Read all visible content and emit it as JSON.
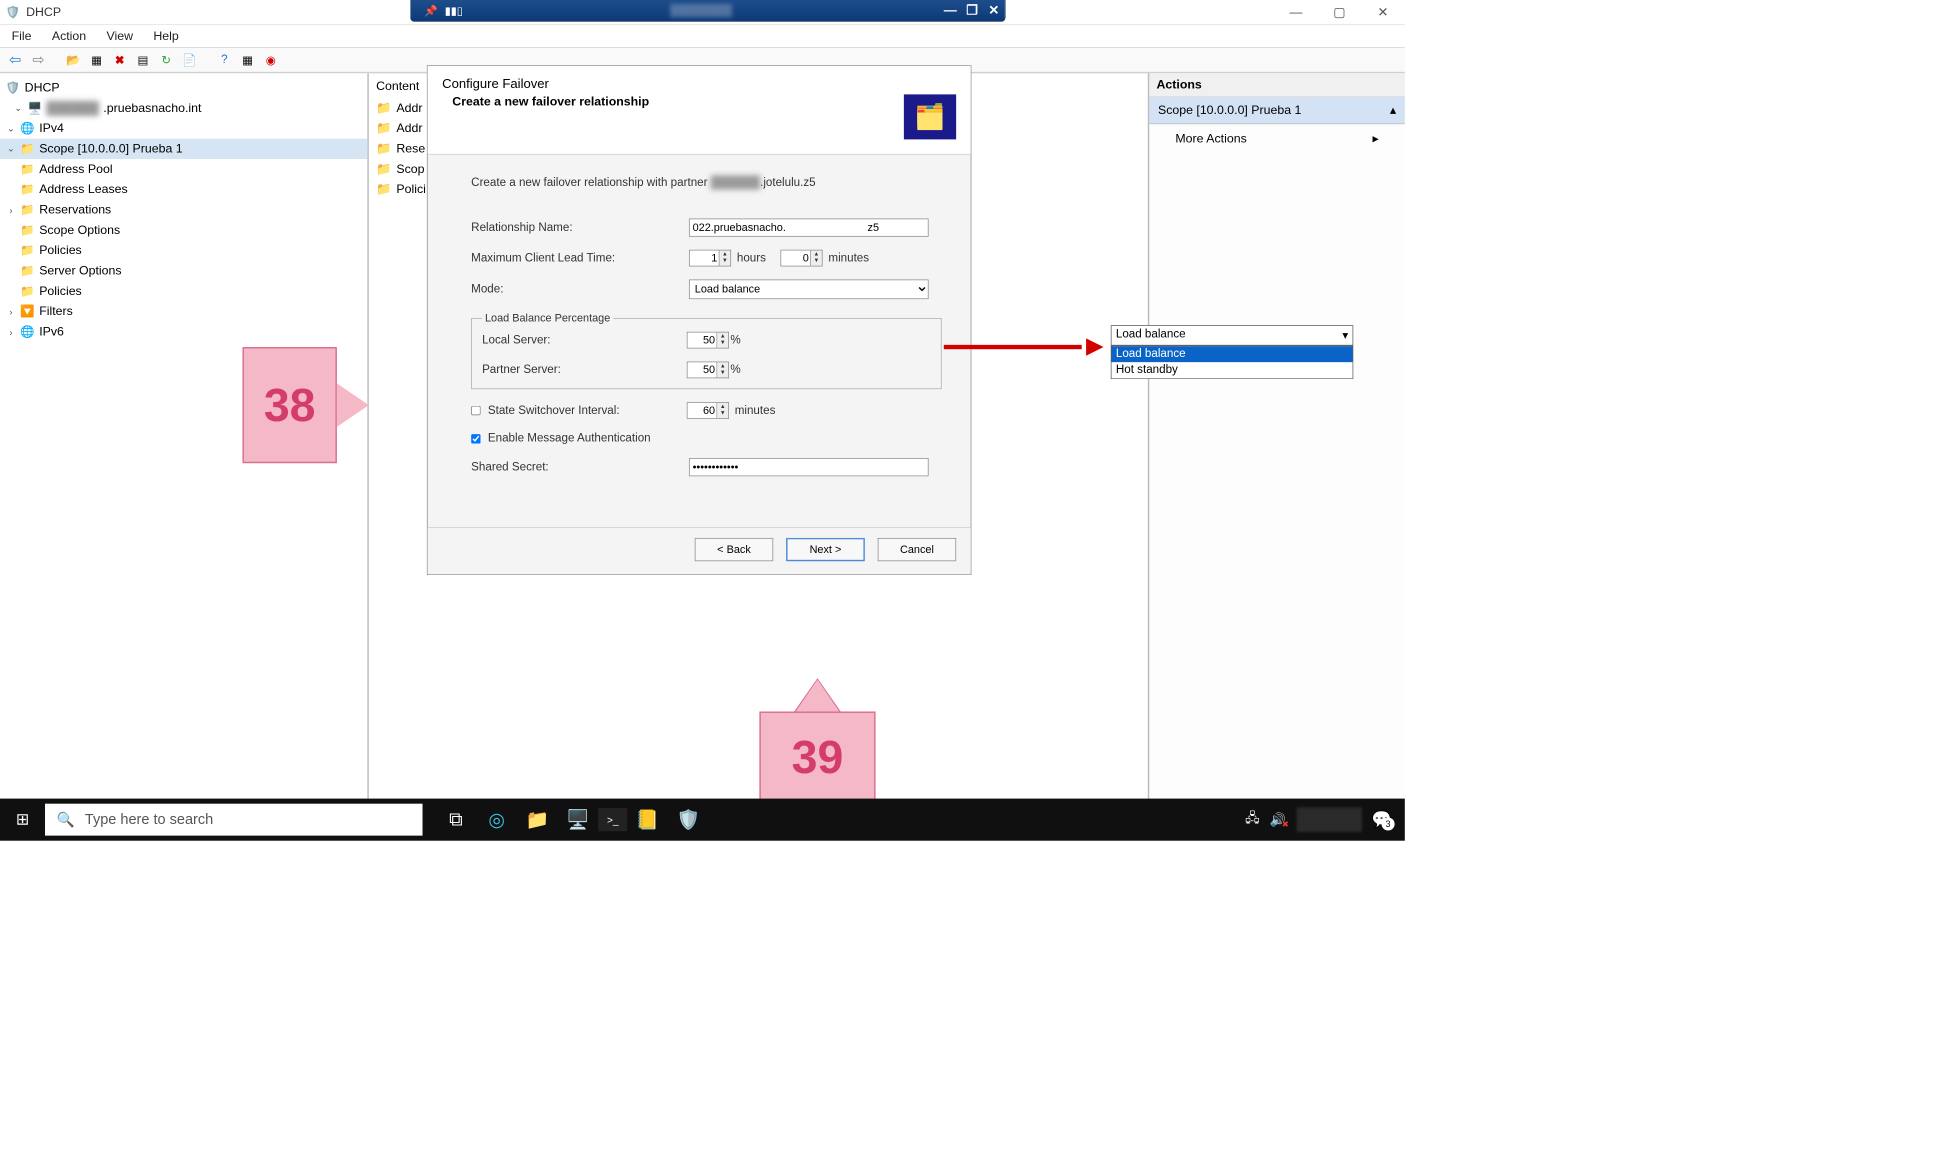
{
  "window": {
    "title": "DHCP",
    "min": "—",
    "max": "▢",
    "close": "✕"
  },
  "remote": {
    "pin": "📌",
    "signal": "▮▮▯",
    "min": "—",
    "restore": "❐",
    "close": "✕"
  },
  "menu": [
    "File",
    "Action",
    "View",
    "Help"
  ],
  "tree": {
    "root": "DHCP",
    "server": ".pruebasnacho.int",
    "ipv4": "IPv4",
    "scope": "Scope [10.0.0.0] Prueba 1",
    "items": [
      "Address Pool",
      "Address Leases",
      "Reservations",
      "Scope Options",
      "Policies"
    ],
    "ipv4_items": [
      "Server Options",
      "Policies",
      "Filters"
    ],
    "ipv6": "IPv6"
  },
  "content": {
    "header": "Content",
    "rows": [
      "Addr",
      "Addr",
      "Rese",
      "Scop",
      "Polici"
    ]
  },
  "actions": {
    "header": "Actions",
    "scope": "Scope [10.0.0.0] Prueba 1",
    "more": "More Actions"
  },
  "dialog": {
    "title": "Configure Failover",
    "subtitle": "Create a new failover relationship",
    "partner_prefix": "Create a new failover relationship with partner",
    "partner_suffix": ".jotelulu.z5",
    "rel_label": "Relationship Name:",
    "rel_value": "022.pruebasnacho.                           z5",
    "mclt_label": "Maximum Client Lead Time:",
    "hours": "1",
    "hours_unit": "hours",
    "mins": "0",
    "mins_unit": "minutes",
    "mode_label": "Mode:",
    "mode_value": "Load balance",
    "lbp_legend": "Load Balance Percentage",
    "local_label": "Local Server:",
    "local_val": "50",
    "partner_label": "Partner Server:",
    "partner_val": "50",
    "pct": "%",
    "ssi_label": "State Switchover Interval:",
    "ssi_val": "60",
    "ssi_unit": "minutes",
    "ema_label": "Enable Message Authentication",
    "secret_label": "Shared Secret:",
    "secret_val": "••••••••••••",
    "back": "< Back",
    "next": "Next >",
    "cancel": "Cancel"
  },
  "dropdown": {
    "selected": "Load balance",
    "options": [
      "Load balance",
      "Hot standby"
    ]
  },
  "callouts": {
    "c38": "38",
    "c39": "39"
  },
  "taskbar": {
    "search_placeholder": "Type here to search",
    "notif_count": "3"
  }
}
